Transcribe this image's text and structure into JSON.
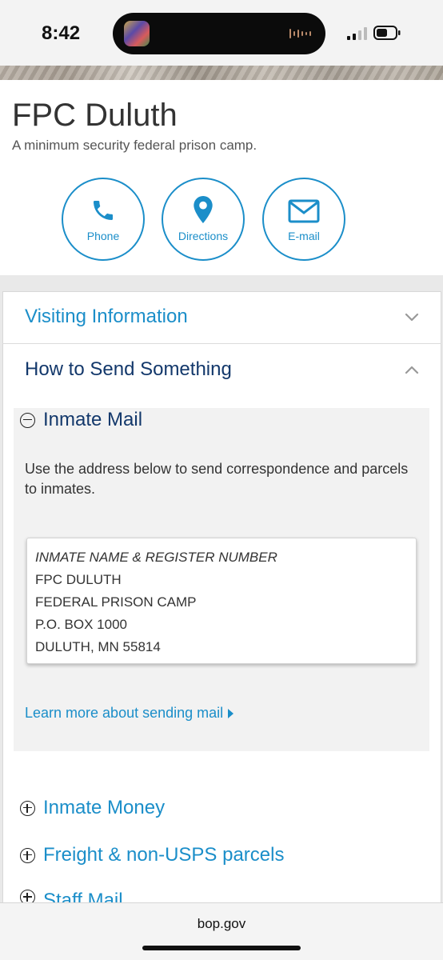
{
  "status": {
    "time": "8:42"
  },
  "header": {
    "title": "FPC Duluth",
    "subtitle": "A minimum security federal prison camp."
  },
  "actions": {
    "phone": "Phone",
    "directions": "Directions",
    "email": "E-mail"
  },
  "accordion": {
    "visiting": "Visiting Information",
    "send": "How to Send Something"
  },
  "inmate_mail": {
    "heading": "Inmate Mail",
    "description": "Use the address below to send correspondence and parcels to inmates.",
    "address": [
      "INMATE NAME & REGISTER NUMBER",
      "FPC DULUTH",
      "FEDERAL PRISON CAMP",
      "P.O. BOX 1000",
      "DULUTH, MN  55814"
    ],
    "learn_more": "Learn more about sending mail"
  },
  "sections": {
    "money": "Inmate Money",
    "freight": "Freight & non-USPS parcels",
    "staff": "Staff Mail"
  },
  "browser": {
    "url": "bop.gov"
  },
  "colors": {
    "link": "#1b8ec9",
    "heading_dark": "#13386b"
  },
  "icons": [
    "phone-icon",
    "map-pin-icon",
    "envelope-icon",
    "chevron-down-icon",
    "chevron-up-icon",
    "minus-circle-icon",
    "plus-circle-icon"
  ]
}
